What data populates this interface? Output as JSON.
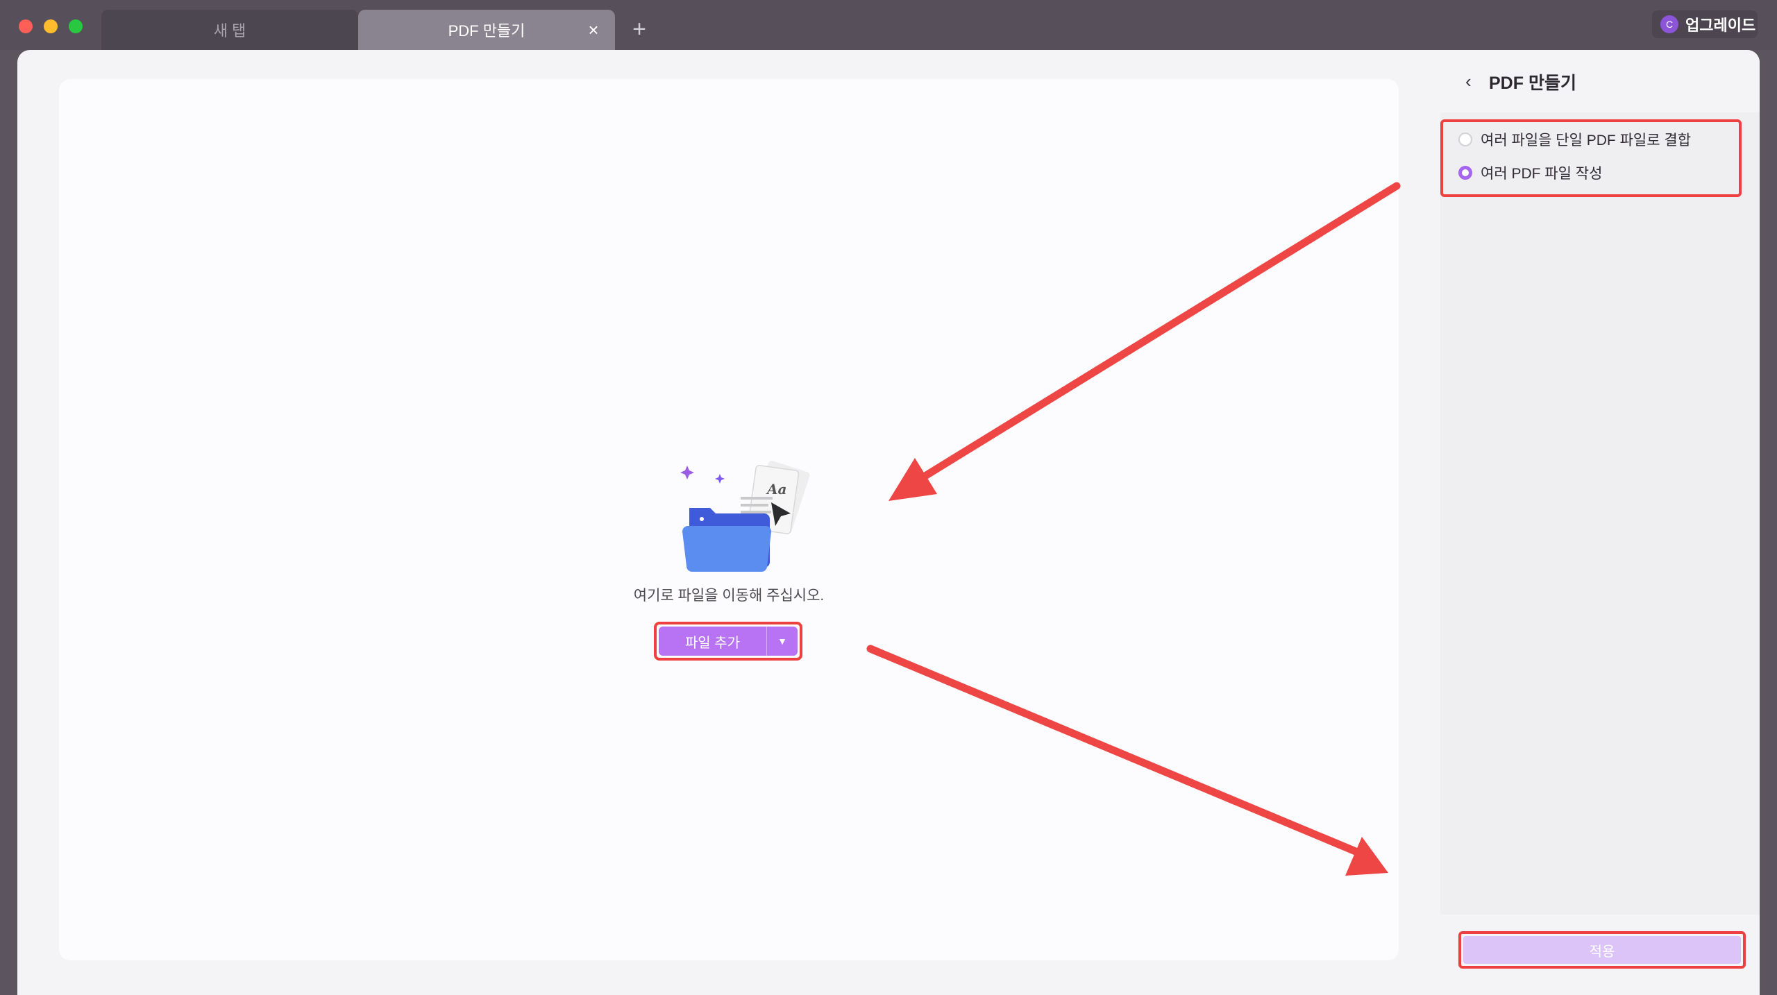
{
  "tabs": [
    {
      "label": "새 탭",
      "active": false
    },
    {
      "label": "PDF 만들기",
      "active": true
    }
  ],
  "header": {
    "close_tab": "×",
    "new_tab": "+",
    "upgrade_avatar": "C",
    "upgrade_label": "업그레이드"
  },
  "main": {
    "drop_text": "여기로 파일을 이동해 주십시오.",
    "add_file_label": "파일 추가",
    "add_file_dropdown": "▼"
  },
  "panel": {
    "back": "‹",
    "title": "PDF 만들기",
    "options": [
      {
        "label": "여러 파일을 단일 PDF 파일로 결합",
        "selected": false
      },
      {
        "label": "여러 PDF 파일 작성",
        "selected": true
      }
    ],
    "apply_label": "적용"
  },
  "colors": {
    "accent": "#b873f5",
    "highlight": "#ee4040",
    "arrow": "#ee4545"
  },
  "icons": {
    "back": "chevron-left-icon",
    "close": "close-icon",
    "add": "plus-icon",
    "illustration": "folder-documents-icon"
  }
}
